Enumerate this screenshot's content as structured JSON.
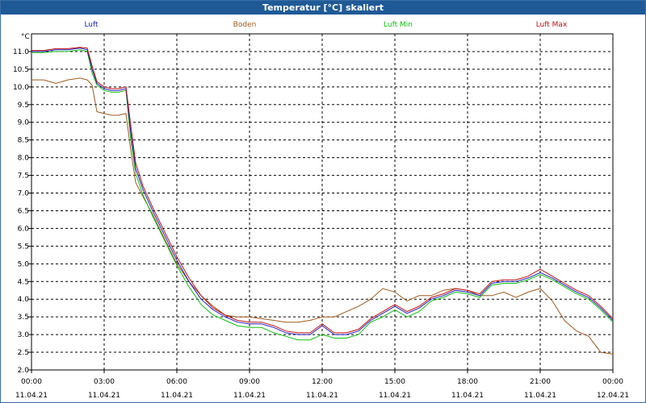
{
  "window": {
    "title": "Temperatur [°C] skaliert"
  },
  "colors": {
    "titlebar": "#1f5a96",
    "luft": "#2020c0",
    "boden": "#a05a1e",
    "luft_min": "#10c010",
    "luft_max": "#c01010"
  },
  "chart_data": {
    "type": "line",
    "title": "Temperatur [°C] skaliert",
    "ylabel": "°C",
    "ylim": [
      2.0,
      11.5
    ],
    "yticks": [
      "2.0",
      "2.5",
      "3.0",
      "3.5",
      "4.0",
      "4.5",
      "5.0",
      "5.5",
      "6.0",
      "6.5",
      "7.0",
      "7.5",
      "8.0",
      "8.5",
      "9.0",
      "9.5",
      "10.0",
      "10.5",
      "11.0"
    ],
    "xlim": [
      0,
      24
    ],
    "xticks": [
      {
        "time": "00:00",
        "date": "11.04.21"
      },
      {
        "time": "03:00",
        "date": "11.04.21"
      },
      {
        "time": "06:00",
        "date": "11.04.21"
      },
      {
        "time": "09:00",
        "date": "11.04.21"
      },
      {
        "time": "12:00",
        "date": "11.04.21"
      },
      {
        "time": "15:00",
        "date": "11.04.21"
      },
      {
        "time": "18:00",
        "date": "11.04.21"
      },
      {
        "time": "21:00",
        "date": "11.04.21"
      },
      {
        "time": "00:00",
        "date": "12.04.21"
      }
    ],
    "grid": true,
    "legend_position": "top",
    "x": [
      0,
      0.5,
      1,
      1.5,
      2,
      2.3,
      2.5,
      2.7,
      3,
      3.3,
      3.6,
      3.9,
      4.1,
      4.3,
      4.6,
      5,
      5.5,
      6,
      6.5,
      7,
      7.5,
      8,
      8.5,
      9,
      9.5,
      10,
      10.5,
      11,
      11.5,
      12,
      12.5,
      13,
      13.5,
      14,
      14.5,
      15,
      15.5,
      16,
      16.5,
      17,
      17.5,
      18,
      18.5,
      19,
      19.5,
      20,
      20.5,
      21,
      21.5,
      22,
      22.5,
      23,
      23.5,
      24
    ],
    "series": [
      {
        "name": "Luft",
        "values": [
          11.0,
          11.0,
          11.05,
          11.05,
          11.1,
          11.05,
          10.5,
          10.1,
          9.95,
          9.9,
          9.9,
          9.95,
          8.7,
          7.7,
          7.1,
          6.5,
          5.8,
          5.1,
          4.5,
          4.0,
          3.7,
          3.5,
          3.35,
          3.3,
          3.3,
          3.2,
          3.05,
          3.0,
          3.0,
          3.25,
          3.0,
          3.0,
          3.1,
          3.4,
          3.6,
          3.8,
          3.6,
          3.75,
          4.0,
          4.1,
          4.25,
          4.2,
          4.1,
          4.45,
          4.5,
          4.5,
          4.6,
          4.75,
          4.6,
          4.4,
          4.2,
          4.05,
          3.75,
          3.4
        ]
      },
      {
        "name": "Boden",
        "values": [
          10.2,
          10.2,
          10.1,
          10.2,
          10.25,
          10.2,
          10.05,
          9.3,
          9.25,
          9.2,
          9.2,
          9.25,
          8.2,
          7.3,
          6.9,
          6.4,
          5.7,
          5.0,
          4.5,
          4.1,
          3.8,
          3.55,
          3.5,
          3.5,
          3.45,
          3.4,
          3.35,
          3.35,
          3.4,
          3.5,
          3.5,
          3.65,
          3.8,
          4.0,
          4.3,
          4.2,
          3.95,
          4.1,
          4.1,
          4.25,
          4.3,
          4.25,
          4.1,
          4.1,
          4.2,
          4.05,
          4.2,
          4.3,
          3.95,
          3.4,
          3.1,
          2.95,
          2.5,
          2.45
        ]
      },
      {
        "name": "Luft Min",
        "values": [
          10.97,
          10.97,
          11.0,
          11.0,
          11.05,
          11.0,
          10.4,
          10.05,
          9.9,
          9.85,
          9.85,
          9.9,
          8.5,
          7.55,
          6.95,
          6.35,
          5.65,
          4.95,
          4.35,
          3.85,
          3.55,
          3.4,
          3.25,
          3.2,
          3.2,
          3.05,
          2.95,
          2.85,
          2.85,
          3.0,
          2.9,
          2.9,
          3.0,
          3.35,
          3.5,
          3.7,
          3.5,
          3.65,
          3.95,
          4.05,
          4.2,
          4.15,
          4.05,
          4.4,
          4.45,
          4.45,
          4.55,
          4.7,
          4.55,
          4.35,
          4.15,
          4.0,
          3.7,
          3.35
        ]
      },
      {
        "name": "Luft Max",
        "values": [
          11.03,
          11.03,
          11.08,
          11.08,
          11.12,
          11.1,
          10.6,
          10.15,
          10.0,
          9.95,
          9.95,
          10.0,
          8.9,
          7.85,
          7.2,
          6.6,
          5.9,
          5.2,
          4.6,
          4.1,
          3.75,
          3.55,
          3.4,
          3.35,
          3.35,
          3.25,
          3.1,
          3.05,
          3.05,
          3.3,
          3.05,
          3.05,
          3.15,
          3.45,
          3.65,
          3.85,
          3.65,
          3.8,
          4.05,
          4.15,
          4.3,
          4.25,
          4.15,
          4.5,
          4.55,
          4.55,
          4.65,
          4.85,
          4.65,
          4.45,
          4.25,
          4.1,
          3.8,
          3.45
        ]
      }
    ]
  }
}
